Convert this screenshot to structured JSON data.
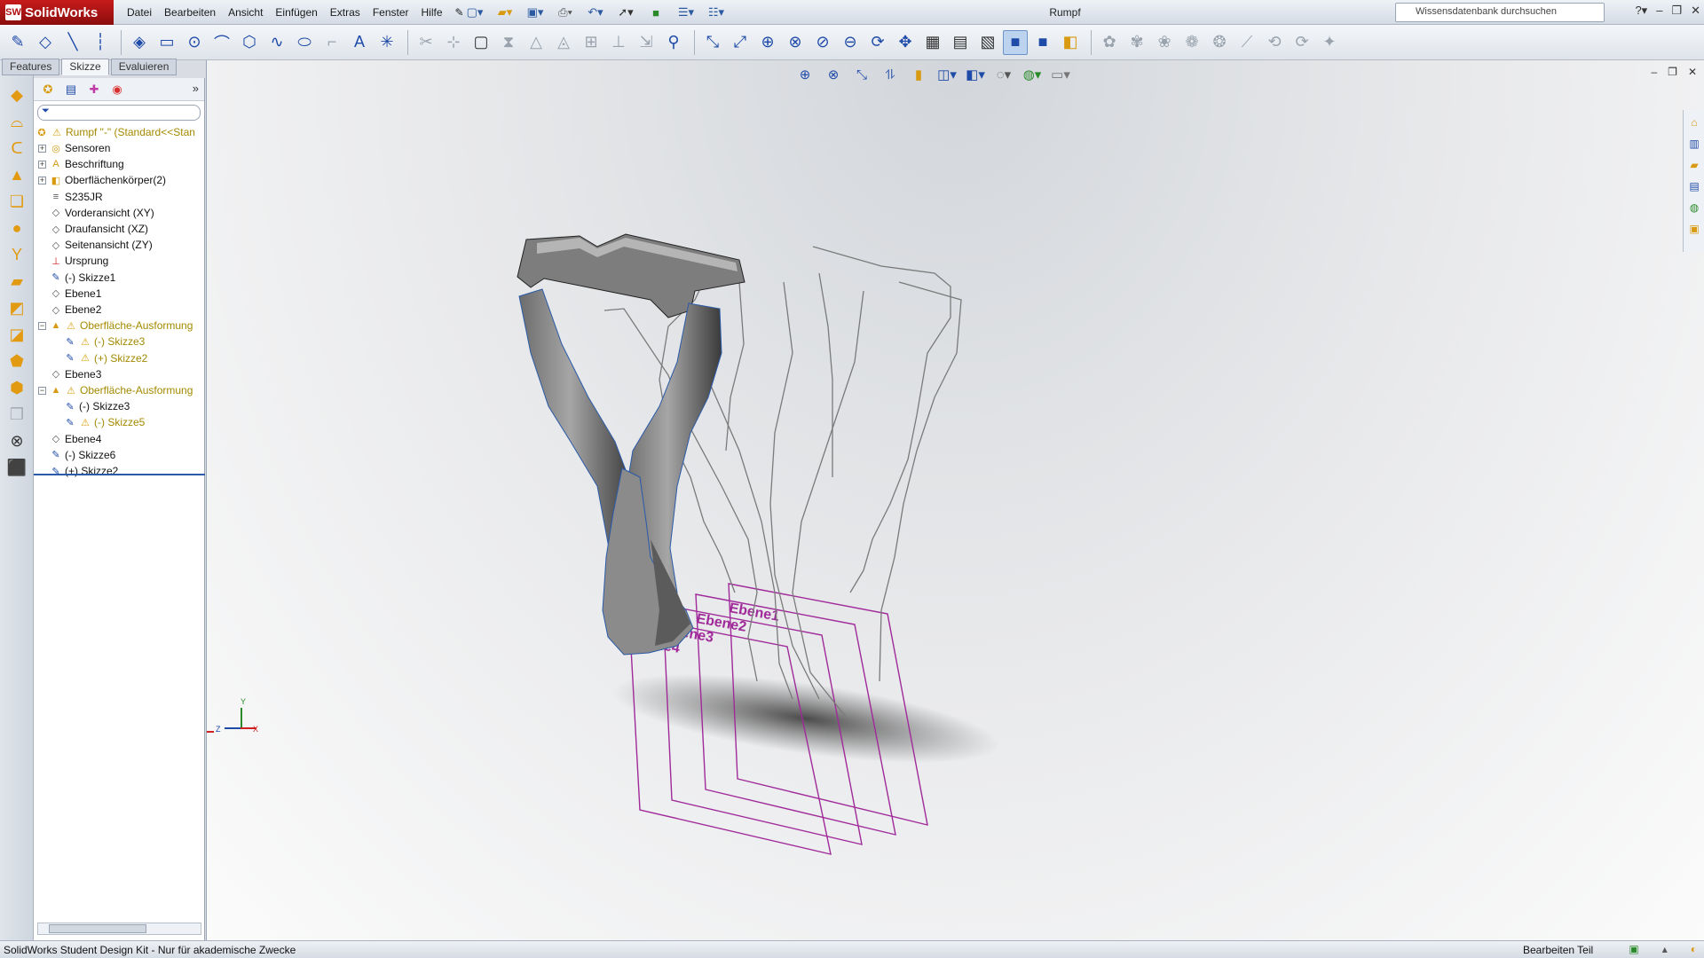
{
  "app": {
    "name": "SolidWorks",
    "logo_mark": "SW"
  },
  "menu": [
    "Datei",
    "Bearbeiten",
    "Ansicht",
    "Einfügen",
    "Extras",
    "Fenster",
    "Hilfe"
  ],
  "document_title": "Rumpf",
  "search": {
    "placeholder": "Wissensdatenbank durchsuchen"
  },
  "tabs": {
    "features": "Features",
    "skizze": "Skizze",
    "evaluieren": "Evaluieren"
  },
  "tree": {
    "root": "Rumpf \"-\" (Standard<<Stan",
    "items": [
      {
        "label": "Sensoren",
        "icon": "sensor-icon"
      },
      {
        "label": "Beschriftung",
        "icon": "annotation-icon"
      },
      {
        "label": "Oberflächenkörper(2)",
        "icon": "surface-bodies-icon"
      },
      {
        "label": "S235JR",
        "icon": "material-icon"
      },
      {
        "label": "Vorderansicht (XY)",
        "icon": "plane-icon"
      },
      {
        "label": "Draufansicht (XZ)",
        "icon": "plane-icon"
      },
      {
        "label": "Seitenansicht (ZY)",
        "icon": "plane-icon"
      },
      {
        "label": "Ursprung",
        "icon": "origin-icon"
      },
      {
        "label": "(-) Skizze1",
        "icon": "sketch-icon"
      },
      {
        "label": "Ebene1",
        "icon": "plane-icon"
      },
      {
        "label": "Ebene2",
        "icon": "plane-icon"
      },
      {
        "label": "Oberfläche-Ausformung",
        "icon": "loft-icon"
      },
      {
        "label": "(-) Skizze3",
        "icon": "sketch-icon"
      },
      {
        "label": "(+) Skizze2",
        "icon": "sketch-icon"
      },
      {
        "label": "Ebene3",
        "icon": "plane-icon"
      },
      {
        "label": "Oberfläche-Ausformung",
        "icon": "loft-icon"
      },
      {
        "label": "(-) Skizze3",
        "icon": "sketch-icon"
      },
      {
        "label": "(-) Skizze5",
        "icon": "sketch-icon"
      },
      {
        "label": "Ebene4",
        "icon": "plane-icon"
      },
      {
        "label": "(-) Skizze6",
        "icon": "sketch-icon"
      },
      {
        "label": "(+) Skizze2",
        "icon": "sketch-icon"
      }
    ]
  },
  "planes": [
    "Ebene1",
    "Ebene2",
    "Ebene3",
    "Ebene4"
  ],
  "triad": {
    "y": "Y",
    "z": "Z",
    "x": "X"
  },
  "status": {
    "left": "SolidWorks Student Design Kit - Nur für akademische Zwecke",
    "right": "Bearbeiten Teil"
  },
  "colors": {
    "accent": "#1e4aa8",
    "logo": "#c71b1b",
    "plane": "#a02a9a",
    "warning": "#a38a00"
  }
}
